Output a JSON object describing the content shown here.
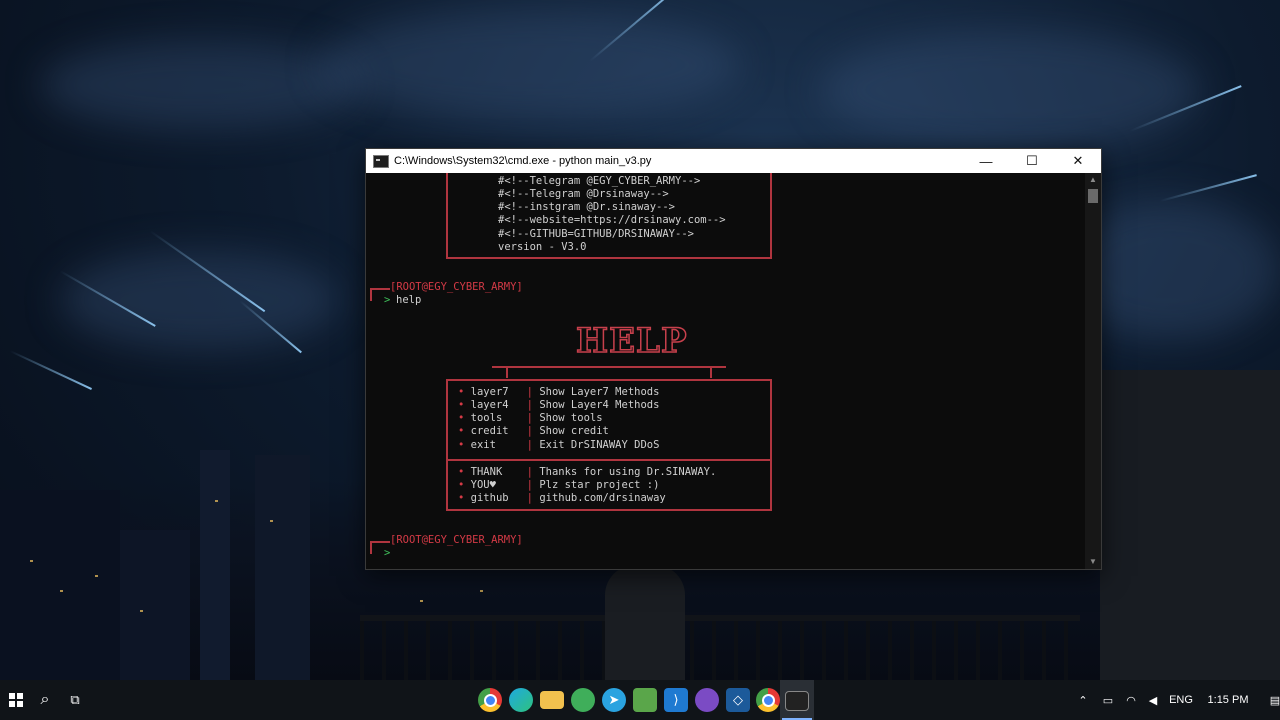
{
  "window": {
    "title": "C:\\Windows\\System32\\cmd.exe - python  main_v3.py",
    "controls": {
      "minimize": "—",
      "maximize": "☐",
      "close": "✕"
    }
  },
  "console": {
    "banner_lines": [
      "#<!--Telegram @EGY_CYBER_ARMY-->",
      "#<!--Telegram @Drsinaway-->",
      "#<!--instgram @Dr.sinaway-->",
      "#<!--website=https://drsinawy.com-->",
      "#<!--GITHUB=GITHUB/DRSINAWAY-->",
      "version - V3.0"
    ],
    "prompt_user": "[ROOT@EGY_CYBER_ARMY]",
    "prompt_arrow": ">",
    "command": "help",
    "help_title": "HELP",
    "menu": [
      {
        "name": "layer7",
        "desc": "Show Layer7 Methods"
      },
      {
        "name": "layer4",
        "desc": "Show Layer4 Methods"
      },
      {
        "name": "tools",
        "desc": "Show tools"
      },
      {
        "name": "credit",
        "desc": "Show credit"
      },
      {
        "name": "exit",
        "desc": "Exit DrSINAWAY DDoS"
      }
    ],
    "info": [
      {
        "name": "THANK",
        "desc": "Thanks for using Dr.SINAWAY."
      },
      {
        "name": "YOU♥",
        "desc": "Plz star project :)"
      },
      {
        "name": "github",
        "desc": "github.com/drsinaway"
      }
    ],
    "bullet": "•",
    "separator": "|"
  },
  "taskbar": {
    "apps": [
      "chrome-icon",
      "edge-icon",
      "file-explorer-icon",
      "maps-icon",
      "telegram-icon",
      "notepad-icon",
      "vscode-icon",
      "github-desktop-icon",
      "virtualbox-icon",
      "chrome-icon",
      "cmd-icon"
    ],
    "tray": {
      "language": "ENG",
      "time": "1:15 PM"
    }
  },
  "colors": {
    "accent_red": "#d43a46",
    "box_border": "#b0353f",
    "prompt_green": "#3fbf5a"
  }
}
